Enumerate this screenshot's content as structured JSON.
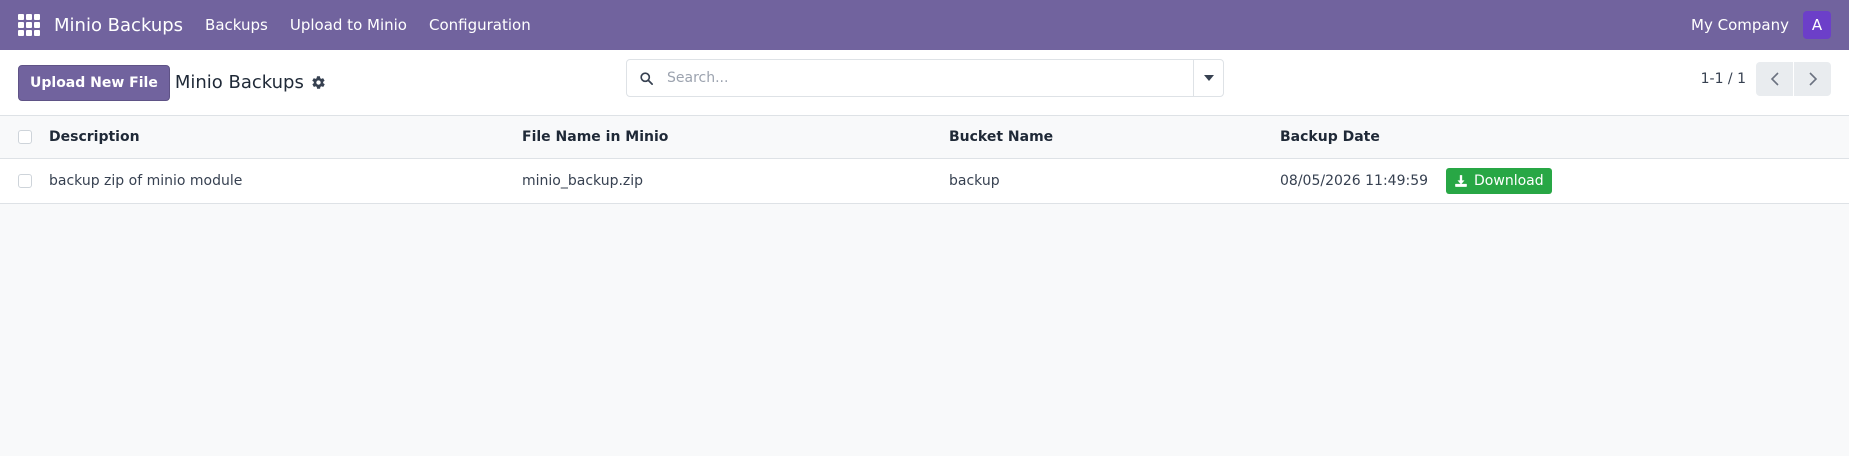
{
  "navbar": {
    "brand": "Minio Backups",
    "menu": [
      "Backups",
      "Upload to Minio",
      "Configuration"
    ],
    "company": "My Company",
    "avatar_initial": "A",
    "bg_color": "#71639e"
  },
  "control_panel": {
    "upload_button": "Upload New File",
    "title": "Minio Backups",
    "search_placeholder": "Search...",
    "pager": "1-1 / 1"
  },
  "table": {
    "columns": [
      "Description",
      "File Name in Minio",
      "Bucket Name",
      "Backup Date"
    ],
    "rows": [
      {
        "description": "backup zip of minio module",
        "file_name": "minio_backup.zip",
        "bucket": "backup",
        "backup_date": "08/05/2026 11:49:59",
        "action": "Download"
      }
    ]
  },
  "icons": {
    "apps": "apps-grid-icon",
    "gear": "gear-icon",
    "search": "search-icon",
    "dropdown": "caret-down-icon",
    "prev": "chevron-left-icon",
    "next": "chevron-right-icon",
    "download": "download-icon"
  },
  "colors": {
    "primary": "#71639e",
    "success": "#28a745",
    "avatar": "#6c3fc9"
  }
}
